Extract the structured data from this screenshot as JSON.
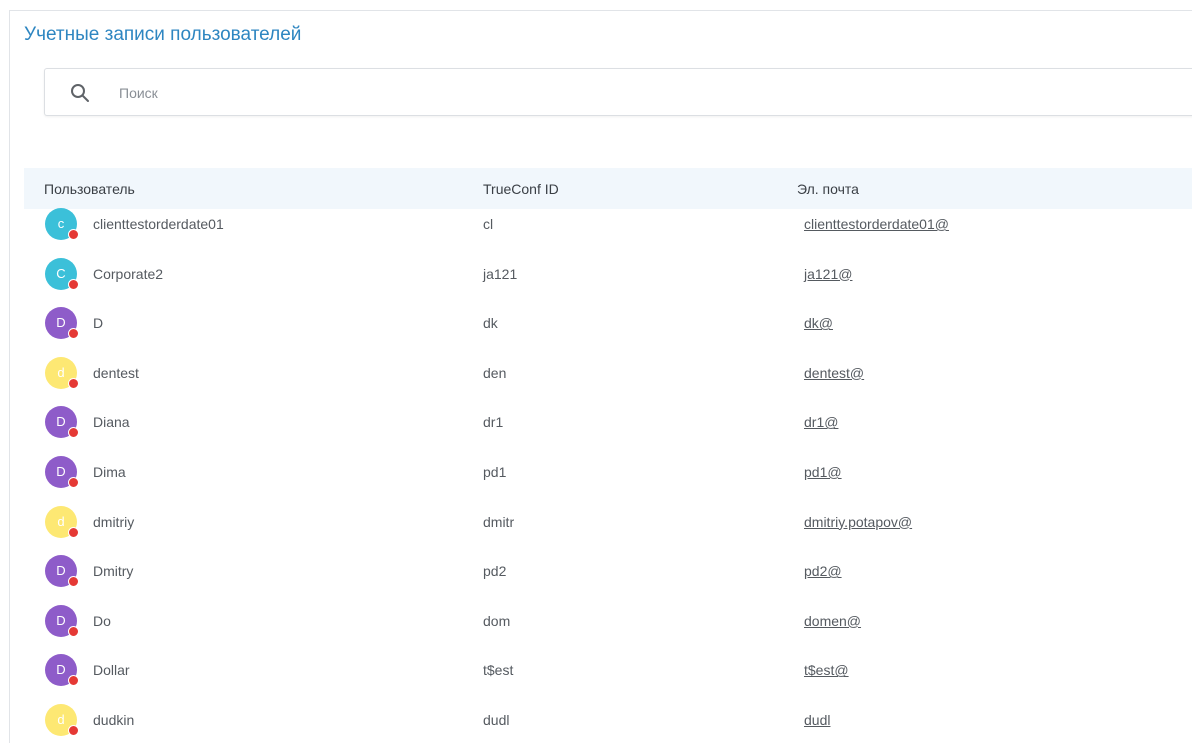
{
  "page": {
    "title": "Учетные записи пользователей"
  },
  "search": {
    "icon": "search-icon",
    "placeholder": "Поиск"
  },
  "table": {
    "columns": [
      "Пользователь",
      "TrueConf ID",
      "Эл. почта"
    ],
    "rows": [
      {
        "initial": "c",
        "avatar_color": "#3bc0d9",
        "name": "clienttestorderdate01",
        "trueconf_id": "cl",
        "email": "clienttestorderdate01@",
        "status": "offline"
      },
      {
        "initial": "C",
        "avatar_color": "#3bc0d9",
        "name": "Corporate2",
        "trueconf_id": "ja121",
        "email": "ja121@",
        "status": "offline"
      },
      {
        "initial": "D",
        "avatar_color": "#8e5cc9",
        "name": "D",
        "trueconf_id": "dk",
        "email": "dk@",
        "status": "offline"
      },
      {
        "initial": "d",
        "avatar_color": "#fde873",
        "name": "dentest",
        "trueconf_id": "den",
        "email": "dentest@",
        "status": "offline"
      },
      {
        "initial": "D",
        "avatar_color": "#8e5cc9",
        "name": "Diana",
        "trueconf_id": "dr1",
        "email": "dr1@",
        "status": "offline"
      },
      {
        "initial": "D",
        "avatar_color": "#8e5cc9",
        "name": "Dima",
        "trueconf_id": "pd1",
        "email": "pd1@",
        "status": "offline"
      },
      {
        "initial": "d",
        "avatar_color": "#fde873",
        "name": "dmitriy",
        "trueconf_id": "dmitr",
        "email": "dmitriy.potapov@",
        "status": "offline"
      },
      {
        "initial": "D",
        "avatar_color": "#8e5cc9",
        "name": "Dmitry",
        "trueconf_id": "pd2",
        "email": "pd2@",
        "status": "offline"
      },
      {
        "initial": "D",
        "avatar_color": "#8e5cc9",
        "name": "Do",
        "trueconf_id": "dom",
        "email": "domen@",
        "status": "offline"
      },
      {
        "initial": "D",
        "avatar_color": "#8e5cc9",
        "name": "Dollar",
        "trueconf_id": "t$est",
        "email": "t$est@",
        "status": "offline"
      },
      {
        "initial": "d",
        "avatar_color": "#fde873",
        "name": "dudkin",
        "trueconf_id": "dudl",
        "email": "dudl",
        "status": "offline"
      }
    ]
  },
  "colors": {
    "accent": "#2e86c1",
    "header_bg": "#f1f7fc",
    "status_offline": "#e53935"
  }
}
